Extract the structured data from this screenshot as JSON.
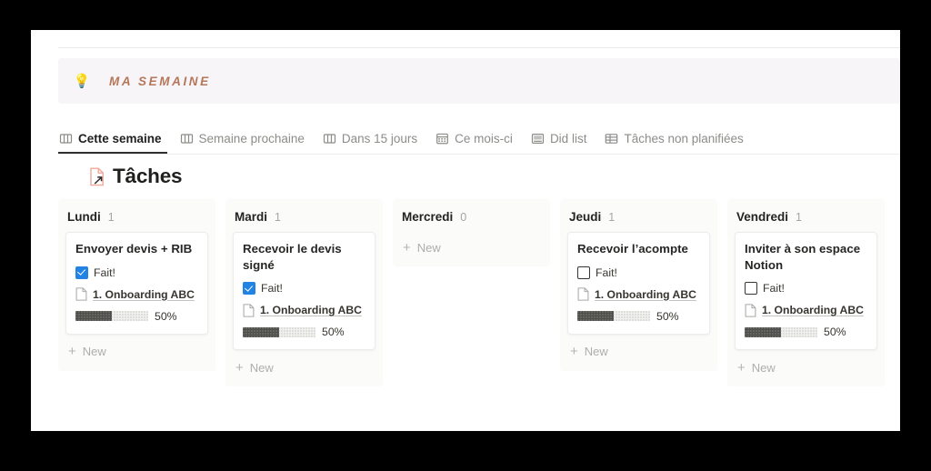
{
  "callout": {
    "emoji": "💡",
    "icon_name": "lightbulb-icon",
    "text": "MA SEMAINE",
    "bg_color": "#f7f5f8",
    "text_color": "#b5765a"
  },
  "tabs": [
    {
      "label": "Cette semaine",
      "icon": "board-view-icon",
      "active": true
    },
    {
      "label": "Semaine prochaine",
      "icon": "board-view-icon",
      "active": false
    },
    {
      "label": "Dans 15 jours",
      "icon": "board-view-icon",
      "active": false
    },
    {
      "label": "Ce mois-ci",
      "icon": "calendar-view-icon",
      "active": false
    },
    {
      "label": "Did list",
      "icon": "gallery-view-icon",
      "active": false
    },
    {
      "label": "Tâches non planifiées",
      "icon": "table-view-icon",
      "active": false
    }
  ],
  "section": {
    "title": "Tâches",
    "icon": "page-link-icon",
    "icon_color": "#f0a89a"
  },
  "new_button_label": "New",
  "board": {
    "columns": [
      {
        "name": "Lundi",
        "count": "1",
        "cards": [
          {
            "title": "Envoyer devis + RIB",
            "checkbox_label": "Fait!",
            "checked": true,
            "relation": "1. Onboarding ABC",
            "progress_label": "50%",
            "progress_value": 50
          }
        ]
      },
      {
        "name": "Mardi",
        "count": "1",
        "cards": [
          {
            "title": "Recevoir le devis signé",
            "checkbox_label": "Fait!",
            "checked": true,
            "relation": "1. Onboarding ABC",
            "progress_label": "50%",
            "progress_value": 50
          }
        ]
      },
      {
        "name": "Mercredi",
        "count": "0",
        "cards": []
      },
      {
        "name": "Jeudi",
        "count": "1",
        "cards": [
          {
            "title": "Recevoir l’acompte",
            "checkbox_label": "Fait!",
            "checked": false,
            "relation": "1. Onboarding ABC",
            "progress_label": "50%",
            "progress_value": 50
          }
        ]
      },
      {
        "name": "Vendredi",
        "count": "1",
        "cards": [
          {
            "title": "Inviter à son espace Notion",
            "checkbox_label": "Fait!",
            "checked": false,
            "relation": "1. Onboarding ABC",
            "progress_label": "50%",
            "progress_value": 50
          }
        ]
      }
    ]
  }
}
